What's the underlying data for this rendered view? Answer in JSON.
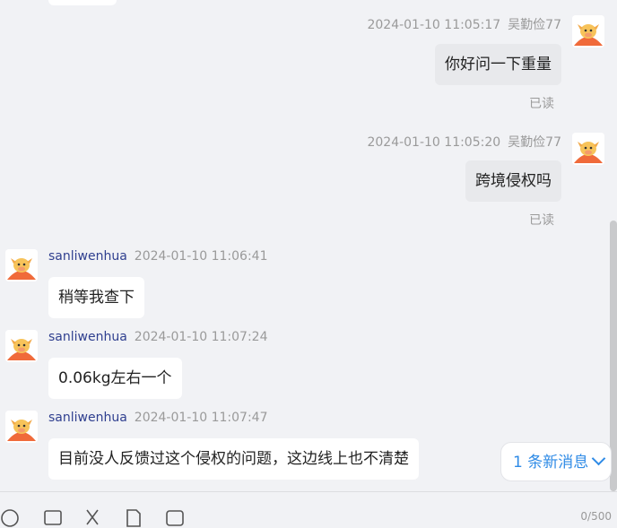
{
  "messages": [
    {
      "side": "right",
      "sender": "吴勤俭77",
      "time": "2024-01-10 11:05:17",
      "text": "你好问一下重量",
      "status": "已读"
    },
    {
      "side": "right",
      "sender": "吴勤俭77",
      "time": "2024-01-10 11:05:20",
      "text": "跨境侵权吗",
      "status": "已读"
    },
    {
      "side": "left",
      "sender": "sanliwenhua",
      "time": "2024-01-10 11:06:41",
      "text": "稍等我查下"
    },
    {
      "side": "left",
      "sender": "sanliwenhua",
      "time": "2024-01-10 11:07:24",
      "text": "0.06kg左右一个"
    },
    {
      "side": "left",
      "sender": "sanliwenhua",
      "time": "2024-01-10 11:07:47",
      "text": "目前没人反馈过这个侵权的问题，这边线上也不清楚"
    }
  ],
  "new_messages_label": "1 条新消息",
  "toolbar": {
    "char_count": "0/500"
  },
  "icons": [
    "emoji-icon",
    "image-icon",
    "scissors-icon",
    "file-icon",
    "video-icon"
  ],
  "colors": {
    "sender_name": "#2f3f8f",
    "new_message": "#2f8be6",
    "own_bubble": "#e8e9ec",
    "other_bubble": "#ffffff"
  }
}
